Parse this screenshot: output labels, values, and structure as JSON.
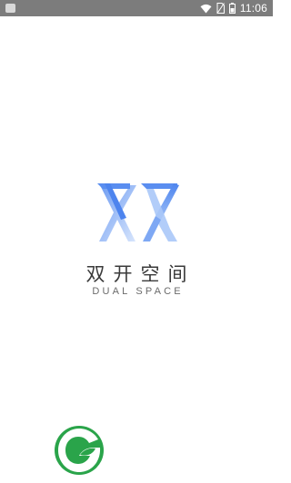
{
  "status_bar": {
    "time": "11:06",
    "battery_label": "1",
    "icons": [
      "notification-icon",
      "wifi-icon",
      "sim-card-icon",
      "battery-icon"
    ]
  },
  "splash": {
    "logo_icon": "dual-space-logo-icon",
    "title_cn": "双开空间",
    "title_en": "DUAL SPACE",
    "accent_colors": [
      "#5a8ef0",
      "#c9dcfb"
    ]
  },
  "footer": {
    "brand_icon": "green-leaf-logo-icon",
    "brand_color": "#2aa44a"
  }
}
